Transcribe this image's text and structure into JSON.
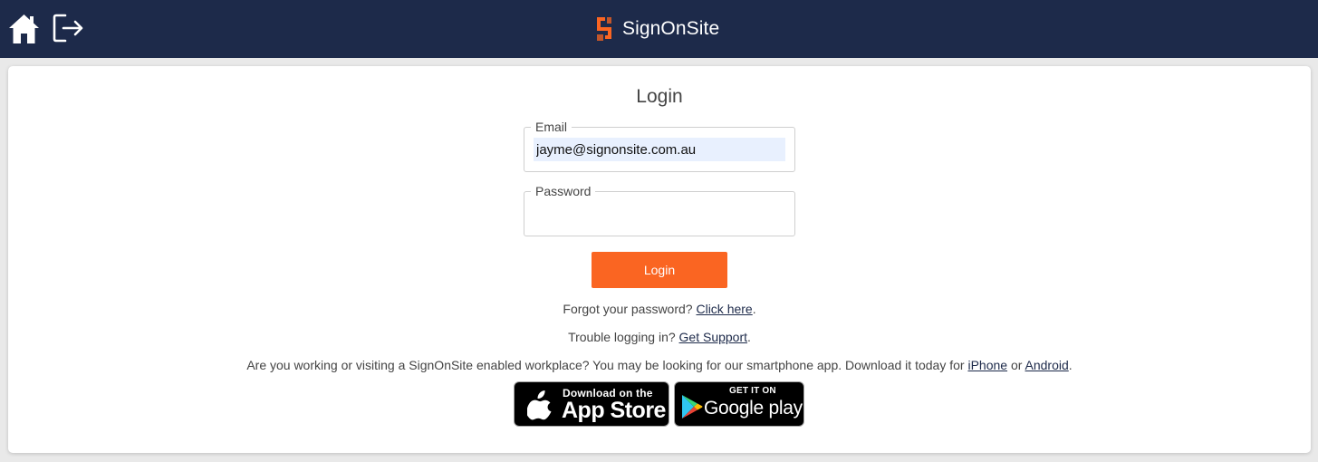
{
  "header": {
    "brand_name": "SignOnSite",
    "brand_colors": {
      "bar": "#1d2a4a",
      "logo": "#fa6522"
    },
    "icons": [
      "home-icon",
      "logout-icon"
    ]
  },
  "login": {
    "title": "Login",
    "email": {
      "label": "Email",
      "value": "jayme@signonsite.com.au"
    },
    "password": {
      "label": "Password",
      "value": ""
    },
    "submit_label": "Login",
    "accent_color": "#fa6522"
  },
  "help": {
    "forgot_prefix": "Forgot your password?",
    "forgot_link": "Click here",
    "forgot_suffix": ".",
    "trouble_prefix": "Trouble logging in?",
    "trouble_link": "Get Support",
    "trouble_suffix": ".",
    "app_prefix": "Are you working or visiting a SignOnSite enabled workplace? You may be looking for our smartphone app. Download it today for",
    "app_link_iphone": "iPhone",
    "app_or": "or",
    "app_link_android": "Android",
    "app_suffix": "."
  },
  "badges": {
    "apple": {
      "small": "Download on the",
      "big": "App Store"
    },
    "google": {
      "small": "GET IT ON",
      "big": "Google play"
    }
  }
}
